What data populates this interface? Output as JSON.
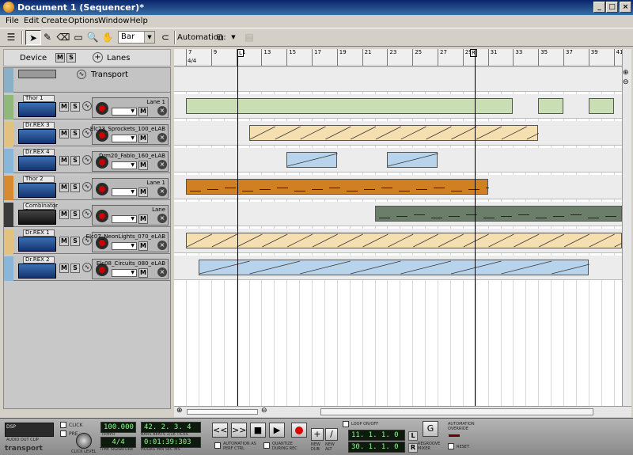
{
  "window": {
    "title": "Document 1 (Sequencer)*",
    "minimize": "_",
    "maximize": "□",
    "close": "×"
  },
  "menu": [
    "File",
    "Edit",
    "Create",
    "Options",
    "Window",
    "Help"
  ],
  "toolbar": {
    "snap_value": "Bar",
    "automation_label": "Automation:"
  },
  "header": {
    "device_label": "Device",
    "m": "M",
    "s": "S",
    "lanes_label": "Lanes"
  },
  "ruler": {
    "time_signature": "4/4",
    "bars": [
      "7",
      "9",
      "11",
      "13",
      "15",
      "17",
      "19",
      "21",
      "23",
      "25",
      "27",
      "29",
      "31",
      "33",
      "35",
      "37",
      "39",
      "41"
    ],
    "left_locator": "L",
    "right_locator": "R"
  },
  "tracks": [
    {
      "device": "",
      "name": "Transport",
      "lane": "",
      "color": "#8ab0c8"
    },
    {
      "device": "Thor 1",
      "name": "",
      "lane": "Lane 1",
      "color": "#8fb87a"
    },
    {
      "device": "Dr.REX 3",
      "name": "",
      "lane": "Elc23_Sprockets_100_eLAB",
      "color": "#e2c27e"
    },
    {
      "device": "Dr.REX 4",
      "name": "",
      "lane": "Drm20_Fablo_160_eLAB",
      "color": "#8ab6da"
    },
    {
      "device": "Thor 2",
      "name": "",
      "lane": "Lane 1",
      "color": "#d88a30"
    },
    {
      "device": "Combinator 1",
      "name": "",
      "lane": "Lane",
      "color": "#3a3a3a"
    },
    {
      "device": "Dr.REX 1",
      "name": "",
      "lane": "Elc07_NeonLights_070_eLAB",
      "color": "#e2c27e"
    },
    {
      "device": "Dr.REX 2",
      "name": "",
      "lane": "Elc08_Circuits_080_eLAB",
      "color": "#8ab6da"
    }
  ],
  "clips": [
    {
      "lane": 1,
      "from": 7,
      "to": 33,
      "color": "#c9dfb3"
    },
    {
      "lane": 1,
      "from": 35,
      "to": 37,
      "color": "#c9dfb3"
    },
    {
      "lane": 1,
      "from": 39,
      "to": 41,
      "color": "#c9dfb3"
    },
    {
      "lane": 2,
      "from": 12,
      "to": 35,
      "color": "#f5deb0",
      "pattern": "saw"
    },
    {
      "lane": 3,
      "from": 15,
      "to": 19,
      "color": "#b8d4ec",
      "pattern": "ramp"
    },
    {
      "lane": 3,
      "from": 23,
      "to": 27,
      "color": "#b8d4ec",
      "pattern": "ramp"
    },
    {
      "lane": 4,
      "from": 7,
      "to": 31,
      "color": "#d07f22",
      "pattern": "notes"
    },
    {
      "lane": 5,
      "from": 22,
      "to": 42,
      "color": "#6b7e6a",
      "pattern": "notes"
    },
    {
      "lane": 6,
      "from": 7,
      "to": 42,
      "color": "#f5deb0",
      "pattern": "saw"
    },
    {
      "lane": 7,
      "from": 8,
      "to": 39,
      "color": "#b8d4ec",
      "pattern": "ramp"
    }
  ],
  "transport": {
    "dsp": "DSP",
    "audio_out_clip": "AUDIO OUT CLIP",
    "click": "CLICK",
    "pre": "PRE",
    "click_level": "CLICK LEVEL",
    "tempo": "100.000",
    "tempo_label": "TEMPO",
    "time_sig": "4/4",
    "time_sig_label": "TIME SIGNATURE",
    "position": "42. 2. 3.  4",
    "position_label": "BARS BEATS 1/16 TICKS",
    "time": "0:01:39:303",
    "time_label": "HOURS  MIN  SEC   MS",
    "rewind": "<<",
    "forward": ">>",
    "stop": "■",
    "play": "▶",
    "automation_label": "AUTOMATION AS PERF CTRL",
    "quantize_label": "QUANTIZE DURING REC",
    "new_dub": "NEW DUB",
    "new_alt": "NEW ALT",
    "loop_label": "LOOP ON/OFF",
    "left_loc": "11. 1. 1.  0",
    "right_loc": "30. 1. 1.  0",
    "regroove": "REGROOVE MIXER",
    "override": "AUTOMATION OVERRIDE",
    "reset": "RESET",
    "brand": "transport"
  }
}
